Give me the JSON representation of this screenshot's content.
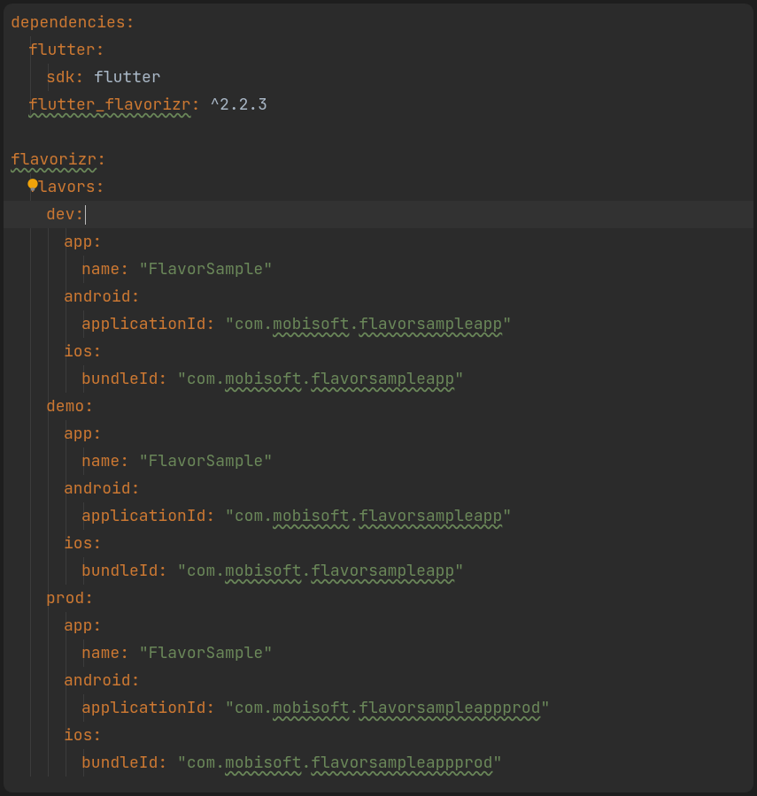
{
  "code": {
    "dependencies": "dependencies",
    "flutter": "flutter",
    "sdk": "sdk",
    "sdk_val": "flutter",
    "flutter_flavorizr": "flutter_flavorizr",
    "flutter_flavorizr_val": "^2.2.3",
    "flavorizr": "flavorizr",
    "flavors": "flavors",
    "dev": "dev",
    "demo": "demo",
    "prod": "prod",
    "app": "app",
    "name": "name",
    "name_val": "\"FlavorSample\"",
    "android": "android",
    "applicationId": "applicationId",
    "ios": "ios",
    "bundleId": "bundleId",
    "bundle_val": "\"com.mobisoft.flavorsampleapp\"",
    "bundle_val_prod": "\"com.mobisoft.flavorsampleappprod\"",
    "q": "\"",
    "com": "com.",
    "mobisoft": "mobisoft",
    "dot": ".",
    "flavorsampleapp": "flavorsampleapp",
    "flavorsampleappprod": "flavorsampleappprod"
  }
}
